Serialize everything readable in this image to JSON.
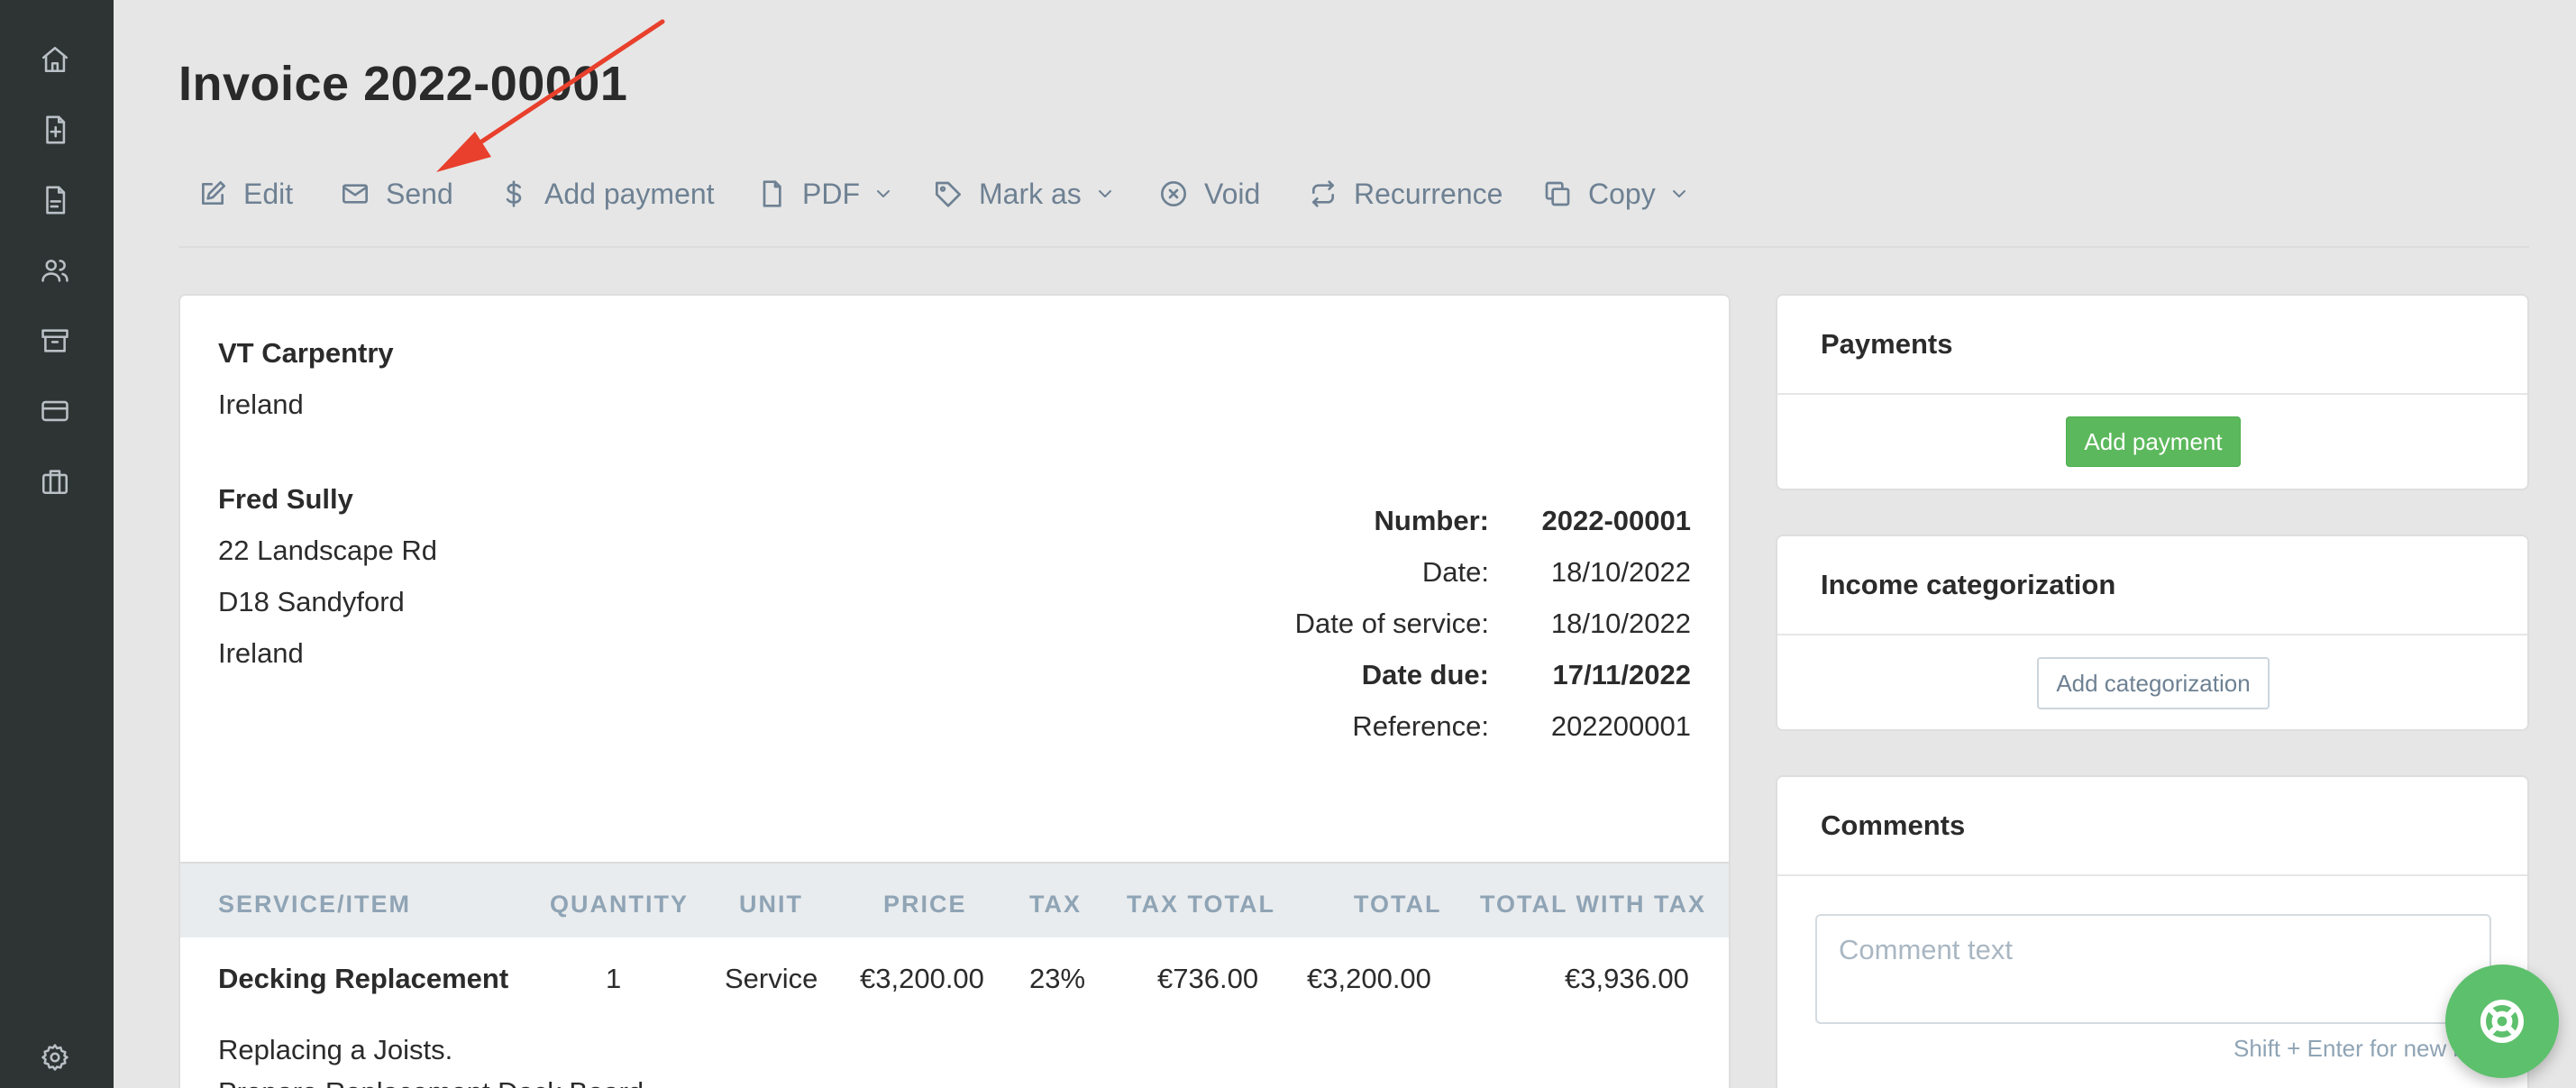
{
  "sidebar": {
    "icons": [
      "home-icon",
      "invoice-add-icon",
      "document-icon",
      "users-icon",
      "archive-icon",
      "credit-card-icon",
      "briefcase-icon",
      "settings-icon"
    ]
  },
  "header": {
    "title": "Invoice 2022-00001"
  },
  "toolbar": {
    "edit": "Edit",
    "send": "Send",
    "add_payment": "Add payment",
    "pdf": "PDF",
    "mark_as": "Mark as",
    "void": "Void",
    "recurrence": "Recurrence",
    "copy": "Copy"
  },
  "invoice": {
    "issuer": {
      "name": "VT Carpentry",
      "country": "Ireland"
    },
    "client": {
      "name": "Fred Sully",
      "address1": "22 Landscape Rd",
      "address2": "D18 Sandyford",
      "country": "Ireland"
    },
    "meta": {
      "number_label": "Number:",
      "number": "2022-00001",
      "date_label": "Date:",
      "date": "18/10/2022",
      "service_label": "Date of service:",
      "service_date": "18/10/2022",
      "due_label": "Date due:",
      "due_date": "17/11/2022",
      "reference_label": "Reference:",
      "reference": "202200001"
    },
    "table": {
      "headers": {
        "item": "SERVICE/ITEM",
        "quantity": "QUANTITY",
        "unit": "UNIT",
        "price": "PRICE",
        "tax": "TAX",
        "tax_total": "TAX TOTAL",
        "total": "TOTAL",
        "total_with_tax": "TOTAL WITH TAX"
      },
      "rows": [
        {
          "item": "Decking Replacement",
          "quantity": "1",
          "unit": "Service",
          "price": "€3,200.00",
          "tax": "23%",
          "tax_total": "€736.00",
          "total": "€3,200.00",
          "total_with_tax": "€3,936.00",
          "description_line1": "Replacing a Joists.",
          "description_line2": "Prepare Replacement Deck Board"
        }
      ]
    }
  },
  "payments": {
    "title": "Payments",
    "button": "Add payment"
  },
  "categorization": {
    "title": "Income categorization",
    "button": "Add categorization"
  },
  "comments": {
    "title": "Comments",
    "placeholder": "Comment text",
    "hint": "Shift + Enter for new line"
  },
  "colors": {
    "sidebar": "#2e3433",
    "accent_green": "#5cb85c",
    "toolbar_text": "#6e8193",
    "annotation_arrow": "#e8402c"
  }
}
